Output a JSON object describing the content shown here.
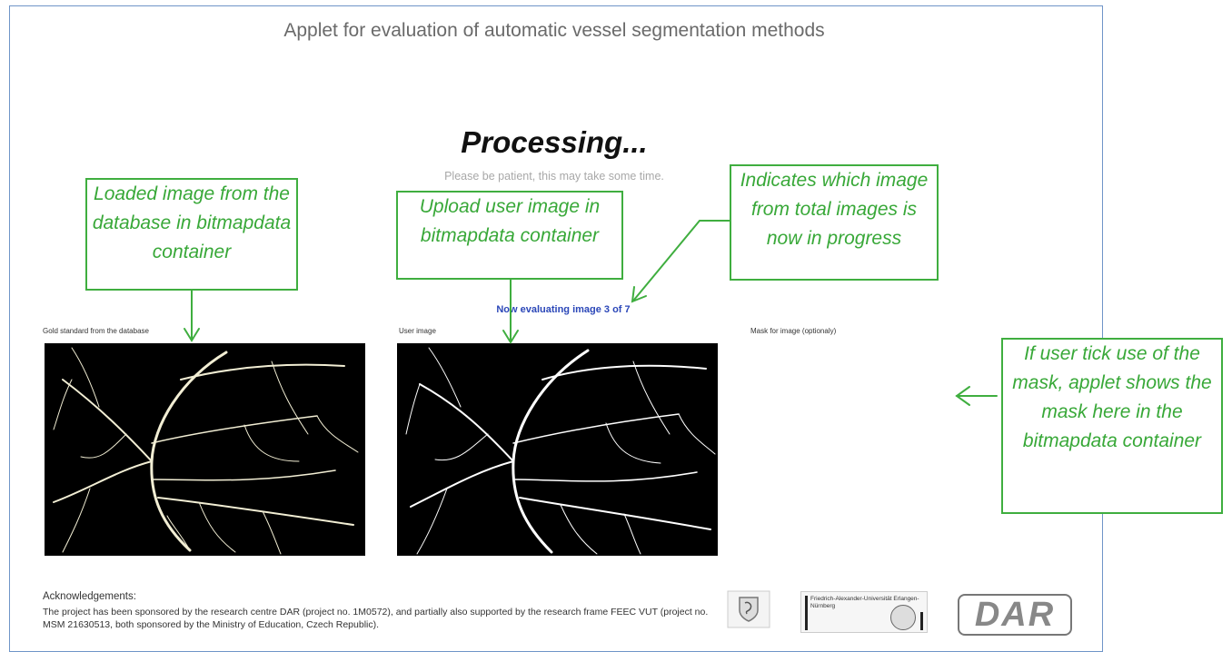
{
  "app": {
    "title": "Applet for evaluation of automatic vessel segmentation methods",
    "processing": "Processing...",
    "patience_message": "Please be patient, this may take some time.",
    "progress_text": "Now evaluating image 3 of 7",
    "progress": {
      "current": 3,
      "total": 7
    }
  },
  "panels": {
    "gold_label": "Gold standard from the database",
    "user_label": "User image",
    "mask_label": "Mask for image (optionaly)"
  },
  "callouts": {
    "loaded": "Loaded image from the database in bitmapdata container",
    "upload": "Upload user image in bitmapdata container",
    "indicates": "Indicates which image from total images is now in progress",
    "mask": "If user tick use of the mask, applet shows the mask here in the bitmapdata container"
  },
  "footer": {
    "ack_title": "Acknowledgements:",
    "ack_text": "The project has been sponsored by the research centre DAR (project no. 1M0572), and partially also supported by the research frame FEEC VUT (project no. MSM 21630513, both sponsored by the Ministry of Education, Czech Republic).",
    "fau_text": "Friedrich-Alexander-Universität Erlangen-Nürnberg",
    "dar_logo": "DAR"
  },
  "colors": {
    "callout_green": "#3fae3f",
    "progress_blue": "#2b47b8",
    "frame_blue": "#6f95c8"
  }
}
